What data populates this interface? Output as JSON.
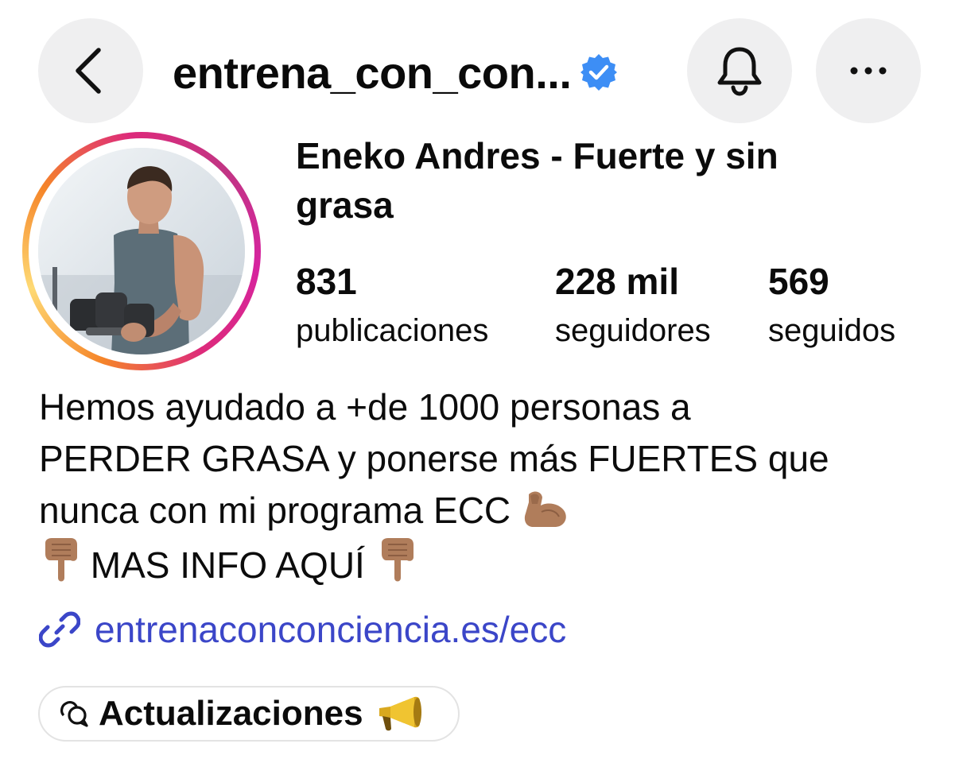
{
  "header": {
    "username": "entrena_con_con...",
    "verified_color": "#3d8ef5",
    "back_icon": "chevron-left-icon",
    "bell_icon": "bell-icon",
    "more_icon": "more-horizontal-icon"
  },
  "profile": {
    "display_name": "Eneko Andres - Fuerte y sin grasa",
    "stats": {
      "posts": {
        "value": "831",
        "label": "publicaciones"
      },
      "followers": {
        "value": "228 mil",
        "label": "seguidores"
      },
      "following": {
        "value": "569",
        "label": "seguidos"
      }
    },
    "bio": {
      "line1": "Hemos ayudado a +de 1000 personas a",
      "line2": "PERDER GRASA y ponerse más FUERTES que",
      "line3": "nunca con mi programa ECC",
      "line4": "MAS INFO AQUÍ"
    },
    "link": {
      "text": "entrenaconconciencia.es/ecc",
      "color": "#3b46c8"
    }
  },
  "updates_pill": {
    "label": "Actualizaciones"
  },
  "colors": {
    "button_bg": "#efeff0",
    "story_ring": [
      "#f58529",
      "#feda75",
      "#dd2a7b",
      "#c13584"
    ]
  }
}
